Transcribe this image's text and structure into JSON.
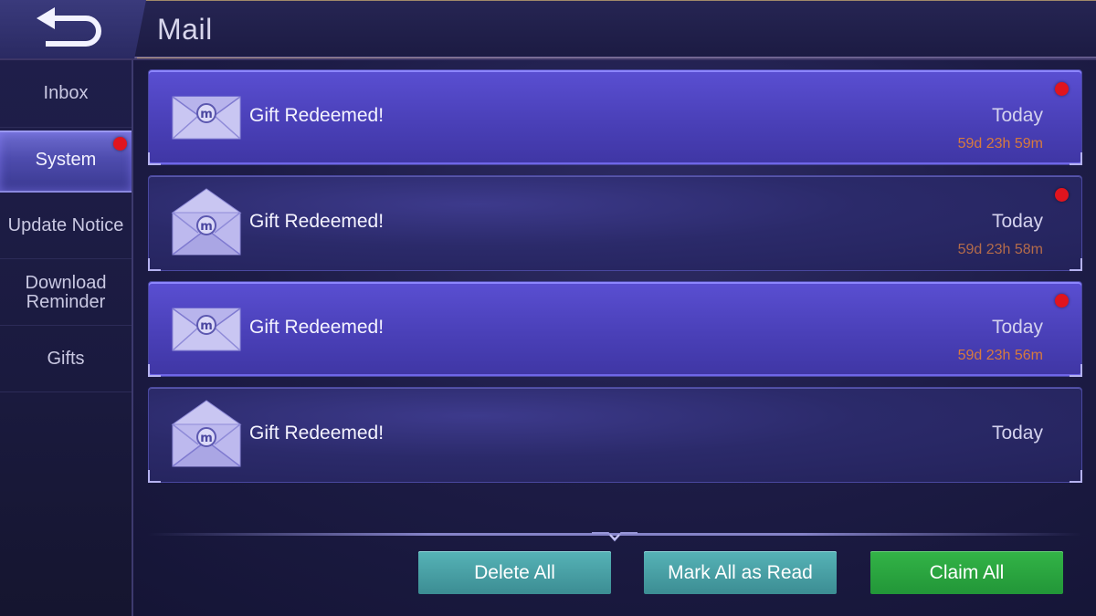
{
  "header": {
    "title": "Mail",
    "back_icon": "back-arrow-icon"
  },
  "sidebar": {
    "items": [
      {
        "label": "Inbox",
        "active": false,
        "badge": false
      },
      {
        "label": "System",
        "active": true,
        "badge": true
      },
      {
        "label": "Update Notice",
        "active": false,
        "badge": false
      },
      {
        "label": "Download Reminder",
        "active": false,
        "badge": false
      },
      {
        "label": "Gifts",
        "active": false,
        "badge": false
      }
    ]
  },
  "mails": [
    {
      "subject": "Gift Redeemed!",
      "date": "Today",
      "expire": "59d 23h 59m",
      "unread": true,
      "icon": "closed-envelope-icon"
    },
    {
      "subject": "Gift Redeemed!",
      "date": "Today",
      "expire": "59d 23h 58m",
      "unread": false,
      "icon": "open-envelope-icon"
    },
    {
      "subject": "Gift Redeemed!",
      "date": "Today",
      "expire": "59d 23h 56m",
      "unread": true,
      "icon": "closed-envelope-icon"
    },
    {
      "subject": "Gift Redeemed!",
      "date": "Today",
      "expire": "",
      "unread": false,
      "icon": "open-envelope-icon"
    }
  ],
  "actions": {
    "delete_all": "Delete All",
    "mark_all_read": "Mark All as Read",
    "claim_all": "Claim All"
  },
  "colors": {
    "badge_red": "#e0141e",
    "claim_green": "#229638",
    "action_teal": "#3c8d93",
    "expire_orange": "#d77a3e"
  }
}
